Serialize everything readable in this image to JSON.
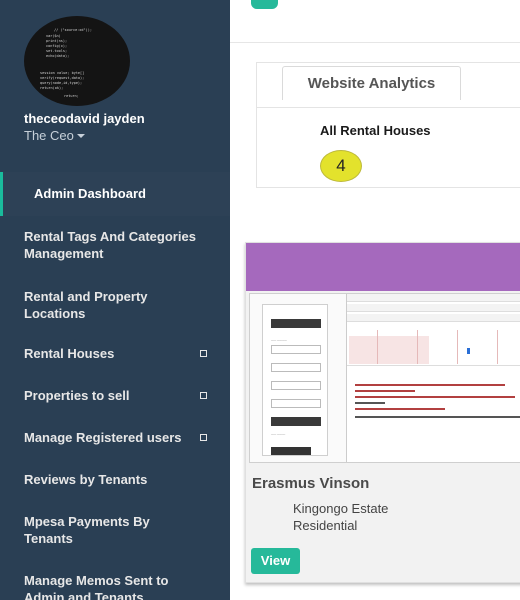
{
  "profile": {
    "username": "theceodavid jayden",
    "role": "The Ceo"
  },
  "sidebar": {
    "items": [
      {
        "label": "Admin Dashboard",
        "active": true,
        "expandable": false
      },
      {
        "label": "Rental Tags And Categories Management",
        "active": false,
        "expandable": false
      },
      {
        "label": "Rental and Property Locations",
        "active": false,
        "expandable": false
      },
      {
        "label": "Rental Houses",
        "active": false,
        "expandable": true
      },
      {
        "label": "Properties to sell",
        "active": false,
        "expandable": true
      },
      {
        "label": "Manage Registered users",
        "active": false,
        "expandable": true
      },
      {
        "label": "Reviews by Tenants",
        "active": false,
        "expandable": false
      },
      {
        "label": "Mpesa Payments By Tenants",
        "active": false,
        "expandable": false
      },
      {
        "label": "Manage Memos Sent to Admin and Tenants",
        "active": false,
        "expandable": false
      }
    ]
  },
  "analytics": {
    "tab_label": "Website Analytics",
    "stat_title": "All Rental Houses",
    "stat_value": "4"
  },
  "card": {
    "name": "Erasmus Vinson",
    "location": "Kingongo Estate",
    "type": "Residential",
    "view_label": "View"
  },
  "colors": {
    "sidebar_bg": "#2a3f54",
    "accent": "#1abb9c",
    "button": "#26b99a",
    "badge": "#e3e22c",
    "card_band": "#a569bd"
  }
}
